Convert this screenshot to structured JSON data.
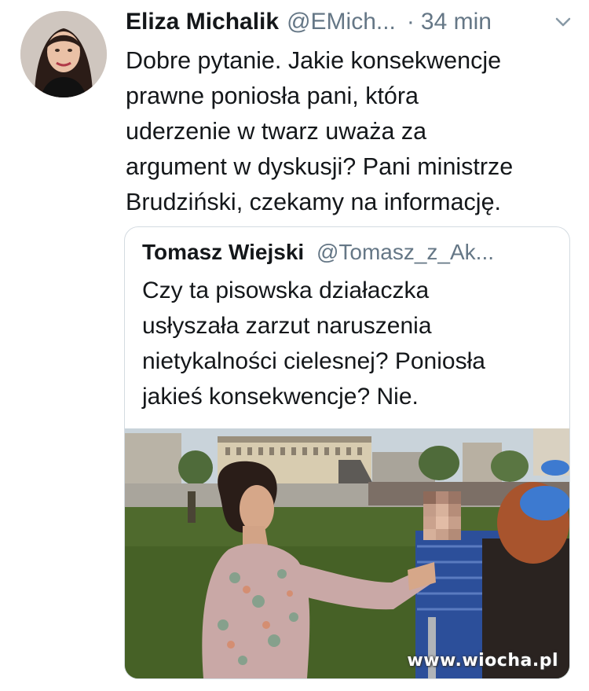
{
  "tweet": {
    "author_name": "Eliza Michalik",
    "author_handle": "@EMich...",
    "separator": "·",
    "time": "34 min",
    "text_lines": [
      "Dobre pytanie. Jakie konsekwencje",
      "prawne poniosła pani, która",
      "uderzenie w twarz uważa za",
      "argument w dyskusji? Pani ministrze",
      "Brudziński, czekamy na informację."
    ]
  },
  "quoted": {
    "author_name": "Tomasz Wiejski",
    "author_handle": "@Tomasz_z_Ak...",
    "text_lines": [
      "Czy ta pisowska działaczka",
      "usłyszała zarzut naruszenia",
      "nietykalności cielesnej? Poniosła",
      "jakieś konsekwencje? Nie."
    ]
  },
  "icons": {
    "menu": "chevron-down-icon"
  },
  "colors": {
    "text": "#14171a",
    "secondary": "#657786",
    "border": "#d4dbe1"
  },
  "watermark": "www.wiocha.pl"
}
